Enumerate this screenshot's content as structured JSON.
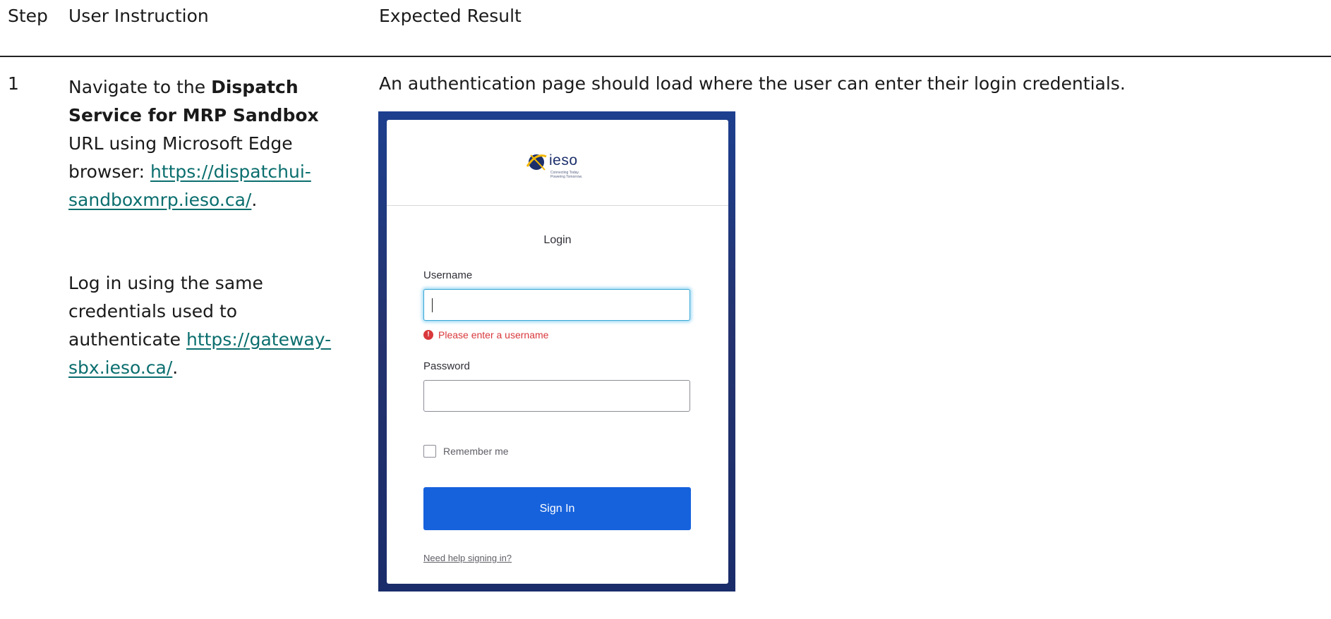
{
  "table": {
    "headers": {
      "step": "Step",
      "instruction": "User Instruction",
      "result": "Expected Result"
    },
    "rows": [
      {
        "step": "1",
        "instruction": {
          "p1_prefix": "Navigate to the ",
          "p1_bold": "Dispatch Service for MRP Sandbox",
          "p1_middle": " URL using Microsoft Edge browser: ",
          "p1_link": "https://dispatchui-sandboxmrp.ieso.ca/",
          "p1_suffix": ".",
          "p2_text": "Log in using the same credentials used to authenticate ",
          "p2_link": "https://gateway-sbx.ieso.ca/",
          "p2_suffix": "."
        },
        "result": {
          "text": "An authentication page should load where the user can enter their login credentials."
        }
      }
    ]
  },
  "login_screenshot": {
    "logo_text": "ieso",
    "logo_tagline_1": "Connecting Today.",
    "logo_tagline_2": "Powering Tomorrow.",
    "title": "Login",
    "username_label": "Username",
    "username_value": "",
    "username_error": "Please enter a username",
    "password_label": "Password",
    "password_value": "",
    "remember_label": "Remember me",
    "remember_checked": false,
    "signin_label": "Sign In",
    "help_link": "Need help signing in?",
    "colors": {
      "frame": "#1d3f8e",
      "button": "#1662dd",
      "error": "#d9383c",
      "link": "#0b6e6e"
    }
  }
}
